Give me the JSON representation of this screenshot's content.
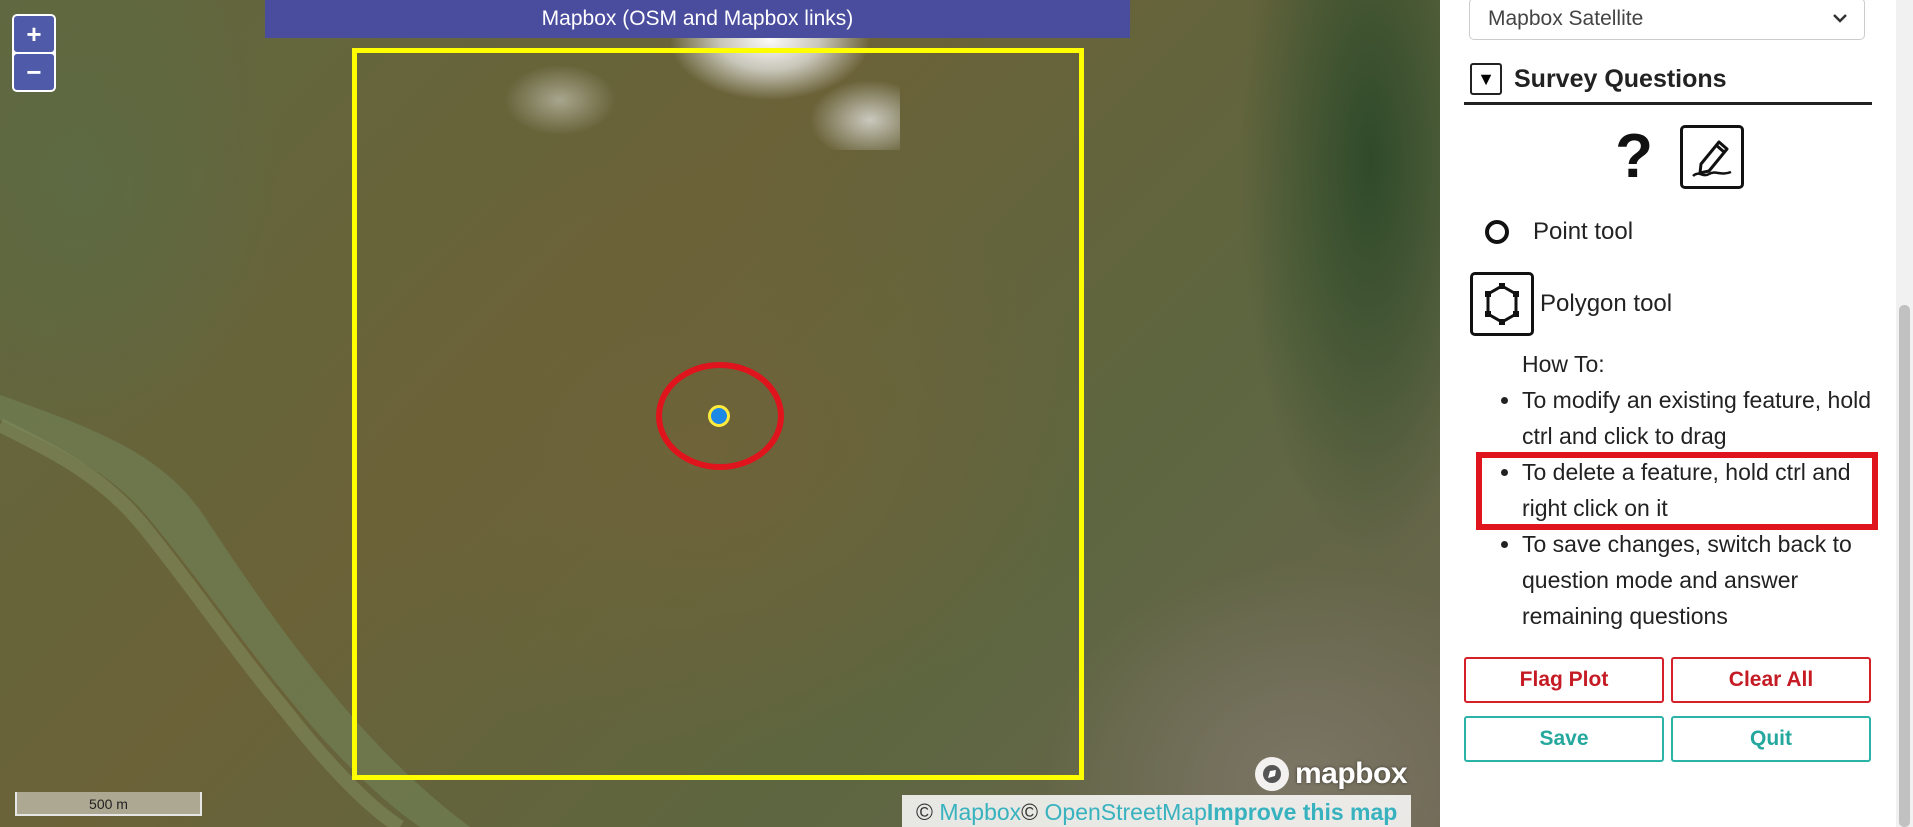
{
  "map": {
    "title": "Mapbox (OSM and Mapbox links)",
    "zoom_in": "+",
    "zoom_out": "−",
    "scale": "500 m",
    "logo_text": "mapbox",
    "attribution": {
      "copyright1": "© ",
      "mapbox_link": "Mapbox",
      "copyright2": "© ",
      "osm_link": "OpenStreetMap",
      "improve_link": "Improve this map"
    },
    "plot_border_color": "#ffff00",
    "annotation_color": "#e0141c"
  },
  "sidebar": {
    "imagery_select": {
      "value": "Mapbox Satellite"
    },
    "survey_header": {
      "toggle": "▼",
      "title": "Survey Questions"
    },
    "mode_icons": {
      "question": "?",
      "edit": "pencil-icon"
    },
    "tools": {
      "point": "Point tool",
      "polygon": "Polygon tool"
    },
    "howto": {
      "title": "How To:",
      "items": [
        "To modify an existing feature, hold ctrl and click to drag",
        "To delete a feature, hold ctrl and right click on it",
        "To save changes, switch back to question mode and answer remaining questions"
      ]
    },
    "buttons": {
      "flag": "Flag Plot",
      "clear": "Clear All",
      "save": "Save",
      "quit": "Quit"
    }
  }
}
